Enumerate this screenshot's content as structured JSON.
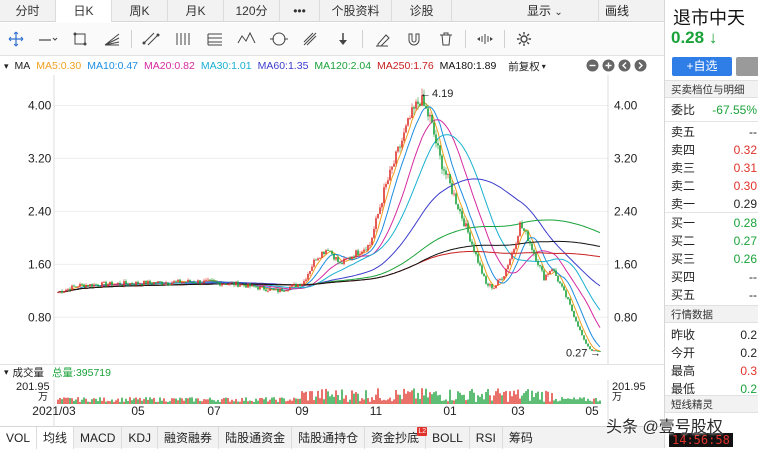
{
  "period_tabs": [
    {
      "label": "分时",
      "width": 38,
      "active": false
    },
    {
      "label": "日K",
      "width": 38,
      "active": true
    },
    {
      "label": "周K",
      "width": 38,
      "active": false
    },
    {
      "label": "月K",
      "width": 38,
      "active": false
    },
    {
      "label": "120分",
      "width": 38,
      "active": false
    },
    {
      "label": "•••",
      "width": 22,
      "active": false
    },
    {
      "label": "个股资料",
      "width": 54,
      "active": false
    },
    {
      "label": "诊股",
      "width": 42,
      "active": false
    }
  ],
  "period_right": {
    "display_label": "显示",
    "draw_label": "画线"
  },
  "ma_bar": {
    "prefix": "MA",
    "items": [
      {
        "label": "MA5:0.30",
        "color": "#f0a020"
      },
      {
        "label": "MA10:0.47",
        "color": "#1c8de0"
      },
      {
        "label": "MA20:0.82",
        "color": "#d62aa0"
      },
      {
        "label": "MA30:1.01",
        "color": "#18b0d0"
      },
      {
        "label": "MA60:1.35",
        "color": "#3c3ccc"
      },
      {
        "label": "MA120:2.04",
        "color": "#1aa23a"
      },
      {
        "label": "MA250:1.76",
        "color": "#c82020"
      },
      {
        "label": "MA180:1.89",
        "color": "#111111"
      }
    ],
    "adjust_label": "前复权"
  },
  "chart_data": {
    "type": "candlestick",
    "y_ticks": [
      "4.00",
      "3.20",
      "2.40",
      "1.60",
      "0.80"
    ],
    "x_ticks": [
      "2021/03",
      "05",
      "07",
      "09",
      "11",
      "01",
      "03",
      "05"
    ],
    "ylim": [
      0.2,
      4.4
    ],
    "high_label": "4.19",
    "low_label": "0.27",
    "high_value": 4.19,
    "low_value": 0.27
  },
  "volume": {
    "title": "成交量",
    "total_label": "总量:395719",
    "axis_value": "201.95",
    "axis_unit": "万"
  },
  "indicator_tabs": [
    {
      "label": "VOL",
      "active": true
    },
    {
      "label": "均线",
      "active": true
    },
    {
      "label": "MACD",
      "active": false
    },
    {
      "label": "KDJ",
      "active": false
    },
    {
      "label": "融资融券",
      "active": false
    },
    {
      "label": "陆股通资金",
      "active": false
    },
    {
      "label": "陆股通持仓",
      "active": false
    },
    {
      "label": "资金抄底",
      "active": false,
      "badge": "L2"
    },
    {
      "label": "BOLL",
      "active": false
    },
    {
      "label": "RSI",
      "active": false
    }
  ],
  "indicator_extra": "筹码",
  "stock": {
    "name": "退市中天",
    "price": "0.28",
    "arrow": "↓"
  },
  "add_button": "+自选",
  "order_book": {
    "title": "买卖档位与明细",
    "ratio_label": "委比",
    "ratio_value": "-67.55%",
    "asks": [
      {
        "label": "卖五",
        "value": "--",
        "tone": "dark"
      },
      {
        "label": "卖四",
        "value": "0.32",
        "tone": "red"
      },
      {
        "label": "卖三",
        "value": "0.31",
        "tone": "red"
      },
      {
        "label": "卖二",
        "value": "0.30",
        "tone": "red"
      },
      {
        "label": "卖一",
        "value": "0.29",
        "tone": "dark"
      }
    ],
    "bids": [
      {
        "label": "买一",
        "value": "0.28",
        "tone": "green"
      },
      {
        "label": "买二",
        "value": "0.27",
        "tone": "green"
      },
      {
        "label": "买三",
        "value": "0.26",
        "tone": "green"
      },
      {
        "label": "买四",
        "value": "--",
        "tone": "dark"
      },
      {
        "label": "买五",
        "value": "--",
        "tone": "dark"
      }
    ]
  },
  "quote": {
    "title": "行情数据",
    "rows": [
      {
        "label": "昨收",
        "value": "0.2",
        "tone": "dark"
      },
      {
        "label": "今开",
        "value": "0.2",
        "tone": "dark"
      },
      {
        "label": "最高",
        "value": "0.3",
        "tone": "red"
      },
      {
        "label": "最低",
        "value": "0.2",
        "tone": "green"
      }
    ]
  },
  "spirit_title": "短线精灵",
  "clock": "14:56:58",
  "watermark": "头条 @壹号股权"
}
